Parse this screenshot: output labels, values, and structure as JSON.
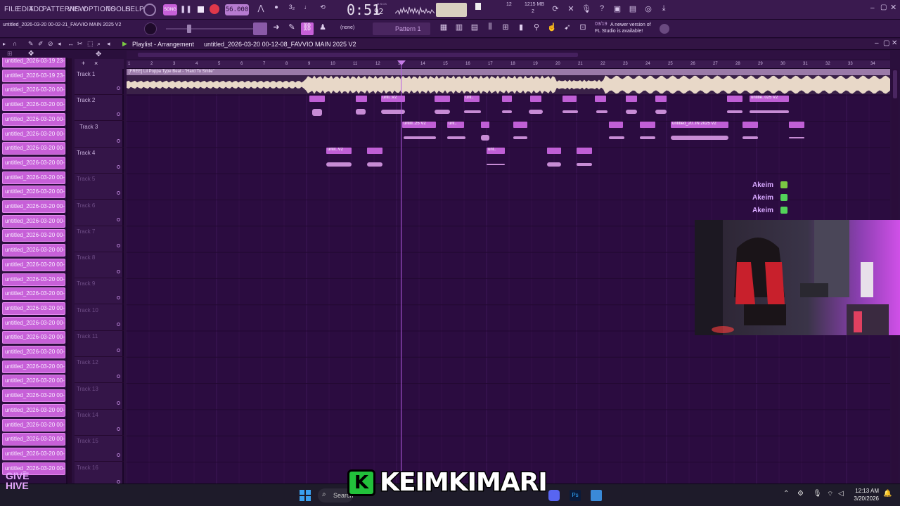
{
  "menus": [
    "FILE",
    "EDIT",
    "ADD",
    "PATTERNS",
    "VIEW",
    "OPTIONS",
    "TOOLS",
    "HELP"
  ],
  "transport": {
    "tempo": "56.000",
    "time": "0:51",
    "time_frac": "92",
    "time_unit": "M:S:CS",
    "cpu": "12",
    "memory": "1215 MB",
    "voices": "2"
  },
  "project_title": "untitled_2026-03-20 00-02-21_FAVVIO MAIN 2025 V2",
  "snap": "(none)",
  "pattern": "Pattern 1",
  "news": {
    "date": "03/19",
    "text": "A newer version of FL Studio is available!"
  },
  "playlist": {
    "title": "Playlist - Arrangement",
    "breadcrumb": "untitled_2026-03-20 00-12-08_FAVVIO MAIN 2025 V2",
    "audio_clip_name": "[FREE] Lil Poppa Type Beat - \"Hard To Smile\""
  },
  "timeline_ticks": [
    "1",
    "2",
    "3",
    "4",
    "5",
    "6",
    "7",
    "8",
    "9",
    "10",
    "11",
    "12",
    "13",
    "14",
    "15",
    "16",
    "17",
    "18",
    "19",
    "20",
    "21",
    "22",
    "23",
    "24",
    "25",
    "26",
    "27",
    "28",
    "29",
    "30",
    "31",
    "32",
    "33",
    "34"
  ],
  "tracks": [
    "Track 1",
    "Track 2",
    "Track 3",
    "Track 4",
    "Track 5",
    "Track 6",
    "Track 7",
    "Track 8",
    "Track 9",
    "Track 10",
    "Track 11",
    "Track 12",
    "Track 13",
    "Track 14",
    "Track 15",
    "Track 16"
  ],
  "browser_items": [
    "untitled_2026-03-19 23-",
    "untitled_2026-03-19 23-",
    "untitled_2026-03-20 00-",
    "untitled_2026-03-20 00-",
    "untitled_2026-03-20 00-",
    "untitled_2026-03-20 00-",
    "untitled_2026-03-20 00-",
    "untitled_2026-03-20 00-",
    "untitled_2026-03-20 00-",
    "untitled_2026-03-20 00-",
    "untitled_2026-03-20 00-",
    "untitled_2026-03-20 00-",
    "untitled_2026-03-20 00-",
    "untitled_2026-03-20 00-",
    "untitled_2026-03-20 00-",
    "untitled_2026-03-20 00-",
    "untitled_2026-03-20 00-",
    "untitled_2026-03-20 00-",
    "untitled_2026-03-20 00-",
    "untitled_2026-03-20 00-",
    "untitled_2026-03-20 00-",
    "untitled_2026-03-20 00-",
    "untitled_2026-03-20 00-",
    "untitled_2026-03-20 00-",
    "untitled_2026-03-20 00-",
    "untitled_2026-03-20 00-",
    "untitled_2026-03-20 00-",
    "untitled_2026-03-20 00-",
    "untitled_2026-03-20 00-"
  ],
  "clip_labels": {
    "t2_a": "unti..V2",
    "t2_b": "unt..",
    "t2_c": "untitle..025 V2",
    "t3_a": "untitl..25 V2",
    "t3_b": "unt..",
    "t3_c": "untitled_20..IN 2025 V2",
    "t4_a": "untit..V2",
    "t4_b": "unt.."
  },
  "chat": [
    {
      "user": "Akeim",
      "icon_color": "#7ac943"
    },
    {
      "user": "Akeim",
      "icon_color": "#53d35a"
    },
    {
      "user": "Akeim",
      "icon_color": "#53d35a"
    }
  ],
  "stream_name": "KEIMKIMARI",
  "overlay_logo": "GIVE HIVE",
  "taskbar": {
    "search_placeholder": "Search",
    "time": "12:13 AM",
    "date": "3/20/2026"
  },
  "colors": {
    "accent": "#c05fd6",
    "background": "#2b0c40",
    "brand_green": "#22c13b"
  }
}
